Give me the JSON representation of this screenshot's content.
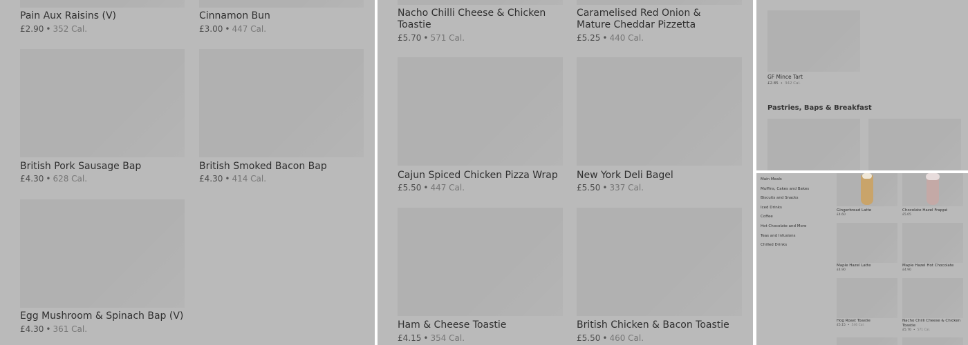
{
  "panel1": {
    "items": [
      {
        "name": "Pain Aux Raisins (V)",
        "price": "£2.90",
        "cal": "352 Cal."
      },
      {
        "name": "Cinnamon Bun",
        "price": "£3.00",
        "cal": "447 Cal."
      },
      {
        "name": "British Pork Sausage Bap",
        "price": "£4.30",
        "cal": "628 Cal."
      },
      {
        "name": "British Smoked Bacon Bap",
        "price": "£4.30",
        "cal": "414 Cal."
      },
      {
        "name": "Egg Mushroom & Spinach Bap (V)",
        "price": "£4.30",
        "cal": "361 Cal."
      }
    ]
  },
  "panel2": {
    "items": [
      {
        "name": "Nacho Chilli Cheese & Chicken Toastie",
        "price": "£5.70",
        "cal": "571 Cal."
      },
      {
        "name": "Caramelised Red Onion & Mature Cheddar Pizzetta",
        "price": "£5.25",
        "cal": "440 Cal."
      },
      {
        "name": "Cajun Spiced Chicken Pizza Wrap",
        "price": "£5.50",
        "cal": "447 Cal."
      },
      {
        "name": "New York Deli Bagel",
        "price": "£5.50",
        "cal": "337 Cal."
      },
      {
        "name": "Ham & Cheese Toastie",
        "price": "£4.15",
        "cal": "354 Cal."
      },
      {
        "name": "British Chicken & Bacon Toastie",
        "price": "£5.50",
        "cal": "460 Cal."
      }
    ]
  },
  "panel3": {
    "items": [
      {
        "name": "GF Mince Tart",
        "price": "£2.85",
        "cal": "342 Cal."
      }
    ],
    "section_title": "Pastries, Baps & Breakfast"
  },
  "panel4": {
    "nav": [
      "Main Meals",
      "Muffins, Cakes and Bakes",
      "Biscuits and Snacks",
      "Iced Drinks",
      "Coffee",
      "Hot Chocolate and More",
      "Teas and Infusions",
      "Chilled Drinks"
    ],
    "items": [
      {
        "name": "Gingerbread Latte",
        "price": "£4.60",
        "cal": ""
      },
      {
        "name": "Chocolate Hazel Frappé",
        "price": "£5.05",
        "cal": ""
      },
      {
        "name": "Maple Hazel Latte",
        "price": "£4.90",
        "cal": ""
      },
      {
        "name": "Maple Hazel Hot Chocolate",
        "price": "£4.90",
        "cal": ""
      },
      {
        "name": "Hog Roast Toastie",
        "price": "£5.15",
        "cal": "546 Cal."
      },
      {
        "name": "Nacho Chilli Cheese & Chicken Toastie",
        "price": "£5.70",
        "cal": "571 Cal."
      }
    ]
  },
  "colors": {
    "overlay": "#bababa",
    "placeholder": "#b1b1b1",
    "divider": "#ffffff"
  }
}
